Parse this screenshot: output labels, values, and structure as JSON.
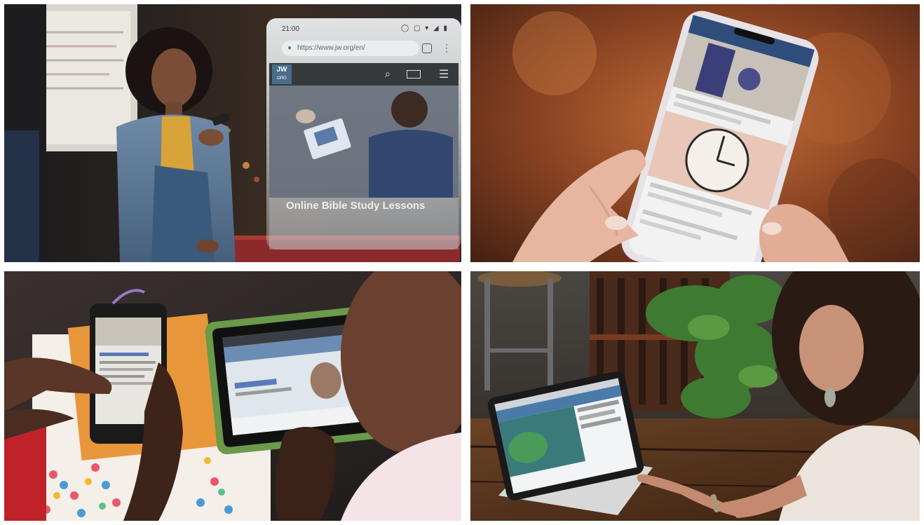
{
  "panels": [
    {
      "id": "panel-1",
      "overlay": {
        "time": "21:00",
        "status_icons": "◯ ▢ ▾ ◢ ▮",
        "url": "https://www.jw.org/en/",
        "logo_line1": "JW",
        "logo_line2": "ORG",
        "caption": "Online Bible Study Lessons"
      }
    },
    {
      "id": "panel-2"
    },
    {
      "id": "panel-3"
    },
    {
      "id": "panel-4"
    }
  ],
  "icons": {
    "lock": "lock-icon",
    "search": "search-icon",
    "language": "language-icon",
    "menu": "hamburger-menu-icon",
    "more": "more-vert-icon"
  }
}
